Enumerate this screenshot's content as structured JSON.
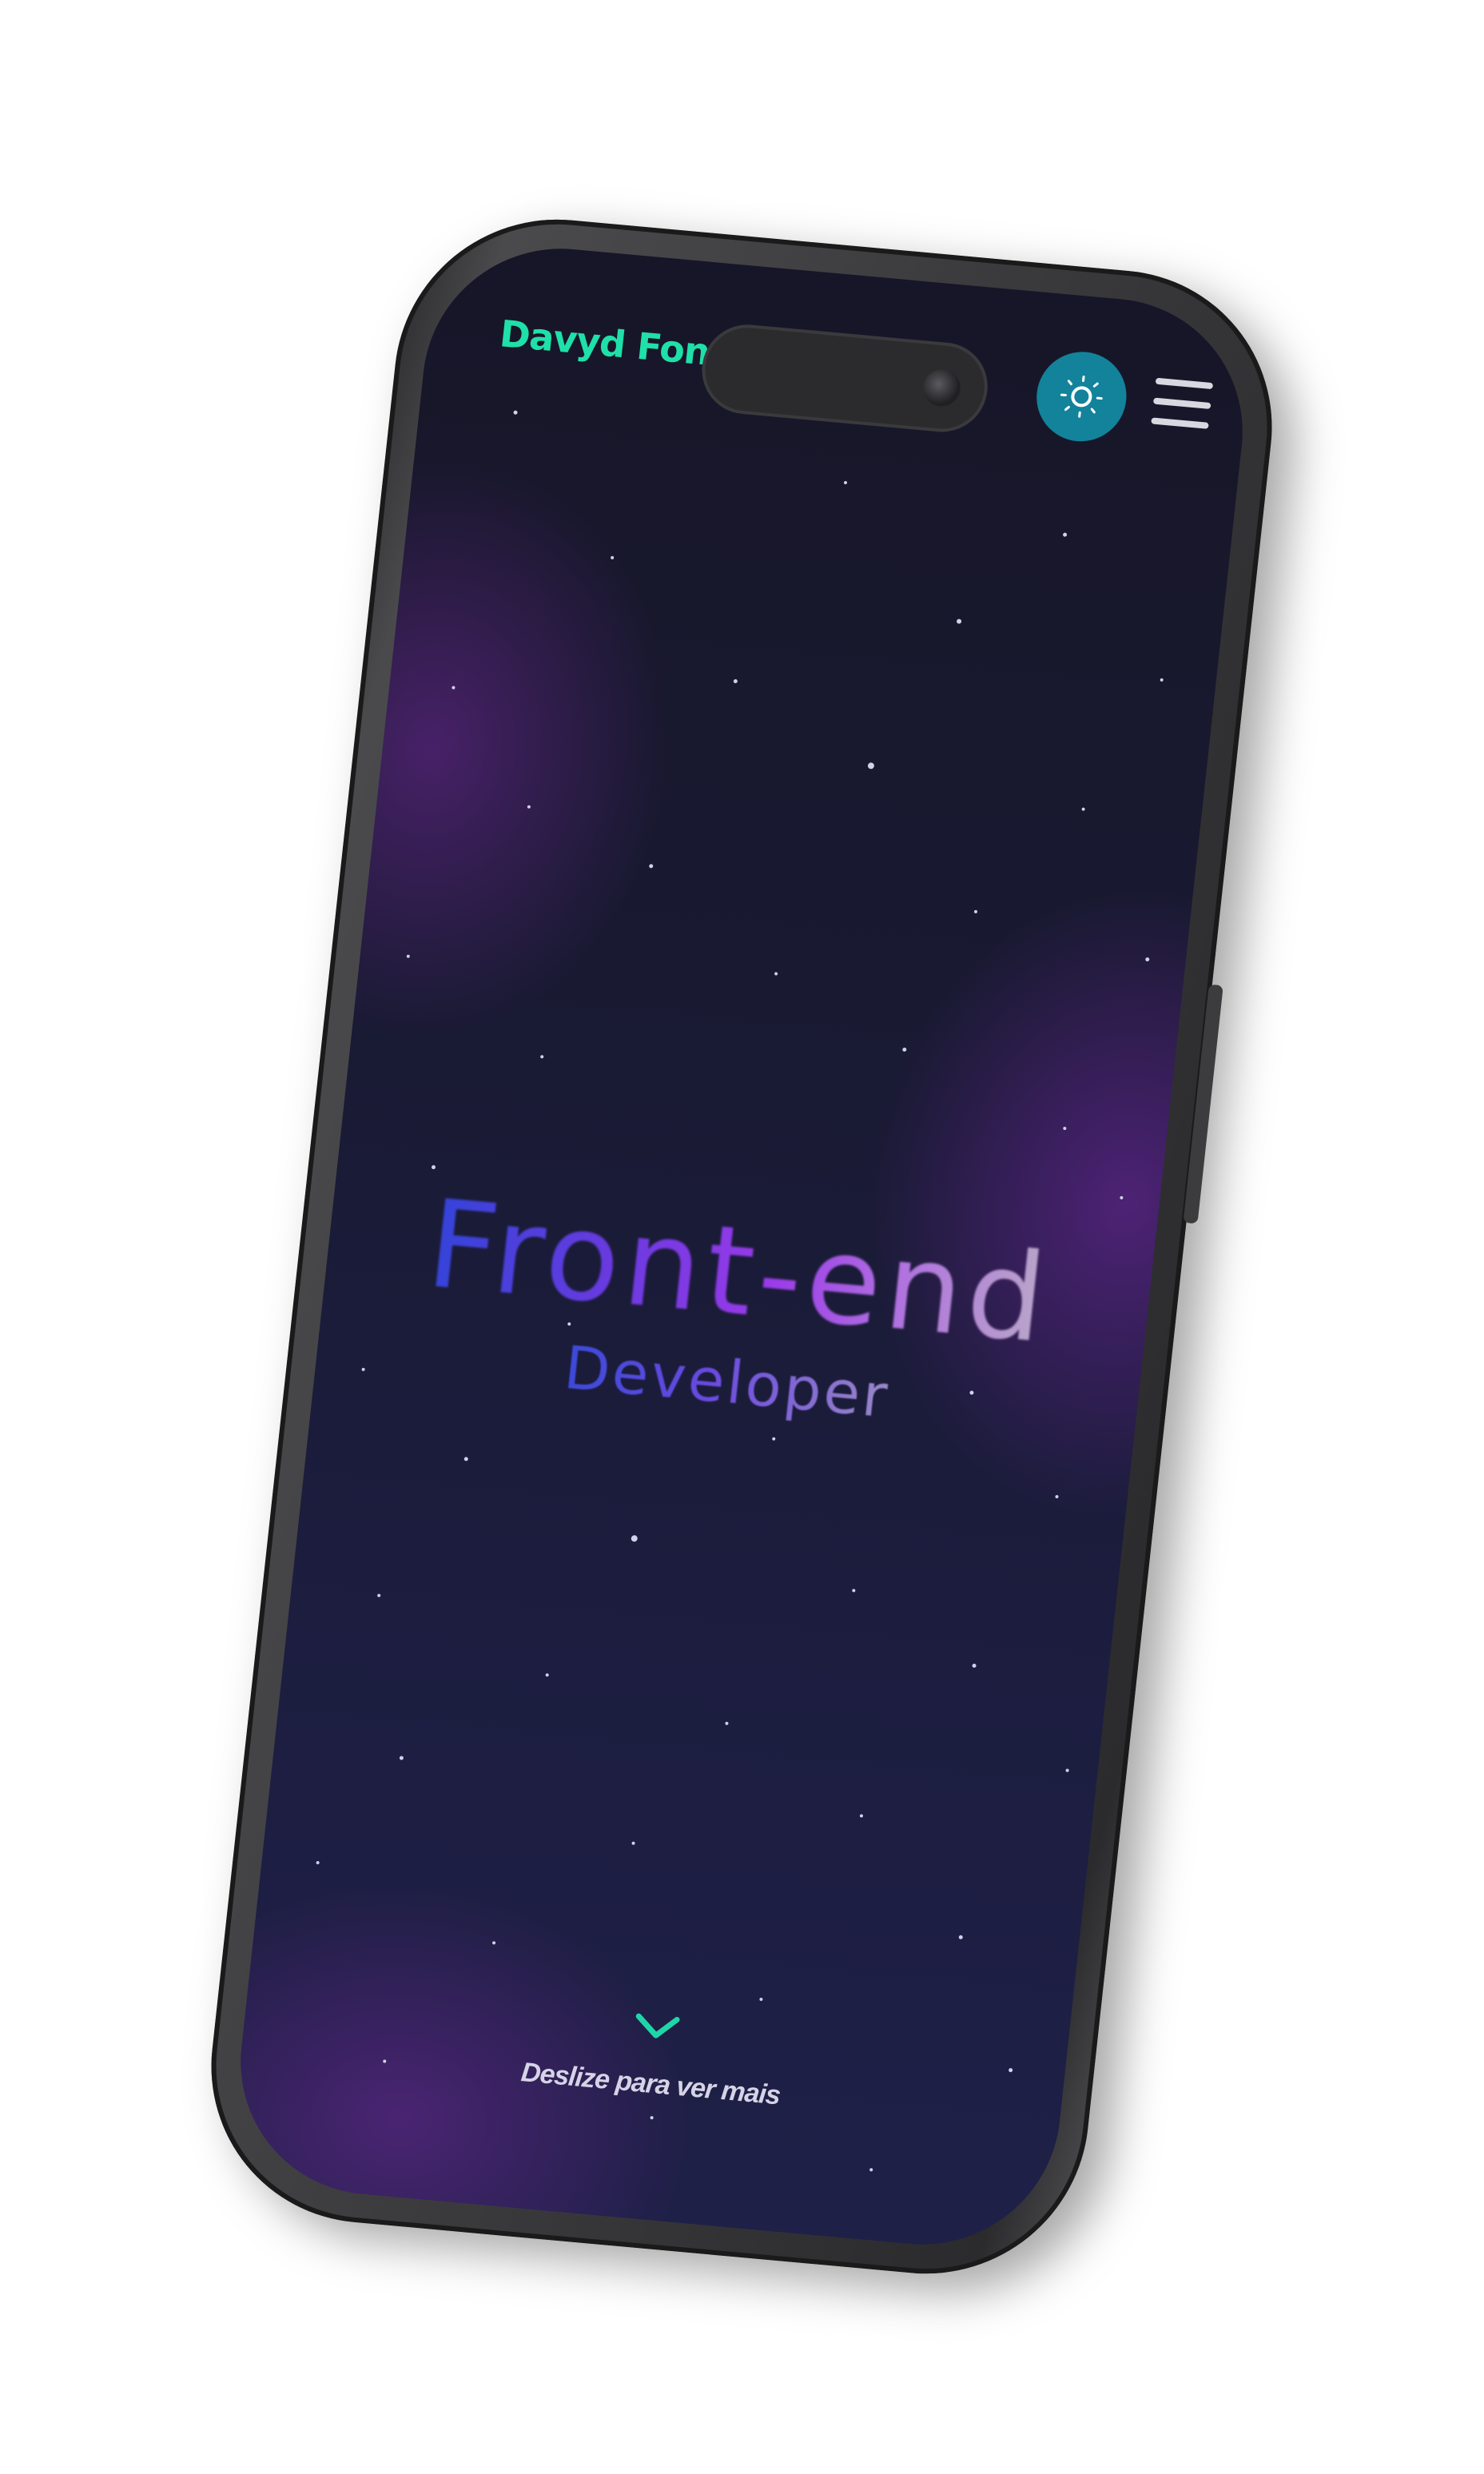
{
  "header": {
    "brand": "Davyd Fonto",
    "theme_toggle_icon": "sun-icon",
    "menu_icon": "hamburger-icon"
  },
  "hero": {
    "title": "Front-end",
    "subtitle": "Developer"
  },
  "scroll_hint": {
    "icon": "chevron-down-icon",
    "label": "Deslize para ver mais"
  },
  "colors": {
    "brand": "#1fe0a8",
    "accent_toggle": "#12839a",
    "background": "#191a33",
    "chevron": "#1fd6a8"
  }
}
